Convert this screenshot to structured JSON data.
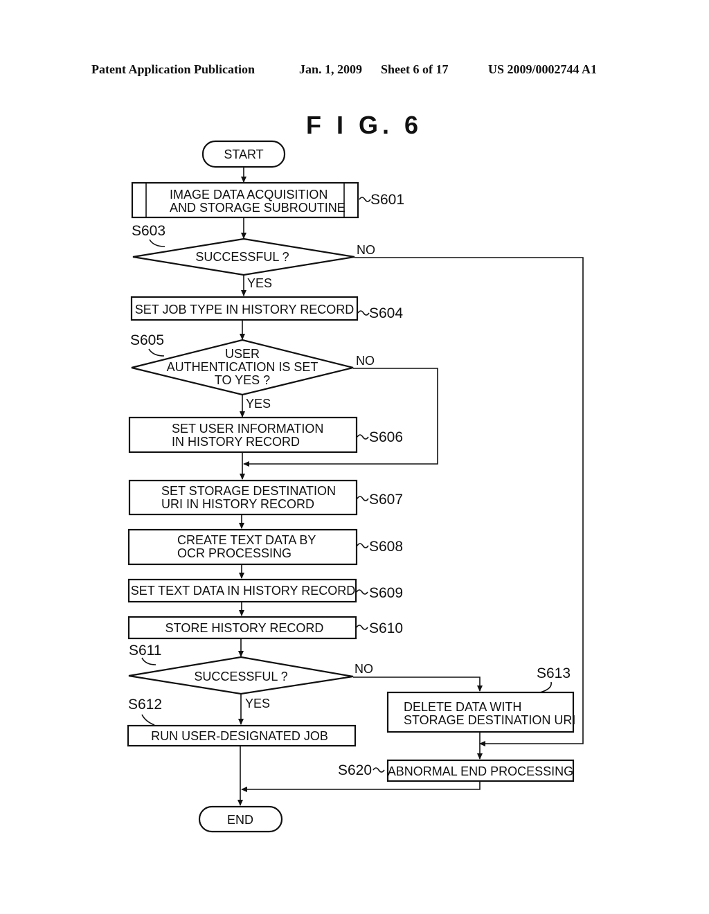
{
  "header": {
    "publication": "Patent Application Publication",
    "date": "Jan. 1, 2009",
    "sheet": "Sheet 6 of 17",
    "number": "US 2009/0002744 A1"
  },
  "figure_title": "F I G. 6",
  "nodes": {
    "start": "START",
    "s601": [
      "IMAGE DATA ACQUISITION",
      "AND STORAGE SUBROUTINE"
    ],
    "s603": [
      "SUCCESSFUL ?"
    ],
    "s604": [
      "SET JOB TYPE IN HISTORY RECORD"
    ],
    "s605": [
      "USER",
      "AUTHENTICATION IS SET",
      "TO YES ?"
    ],
    "s606": [
      "SET USER INFORMATION",
      "IN HISTORY RECORD"
    ],
    "s607": [
      "SET STORAGE DESTINATION",
      "URI IN HISTORY RECORD"
    ],
    "s608": [
      "CREATE TEXT DATA BY",
      "OCR PROCESSING"
    ],
    "s609": [
      "SET TEXT DATA IN HISTORY RECORD"
    ],
    "s610": [
      "STORE HISTORY RECORD"
    ],
    "s611": [
      "SUCCESSFUL ?"
    ],
    "s612": [
      "RUN USER-DESIGNATED JOB"
    ],
    "s613": [
      "DELETE DATA WITH",
      "STORAGE DESTINATION URI"
    ],
    "s620": [
      "ABNORMAL END PROCESSING"
    ],
    "end": "END"
  },
  "step_labels": {
    "s601": "S601",
    "s603": "S603",
    "s604": "S604",
    "s605": "S605",
    "s606": "S606",
    "s607": "S607",
    "s608": "S608",
    "s609": "S609",
    "s610": "S610",
    "s611": "S611",
    "s612": "S612",
    "s613": "S613",
    "s620": "S620"
  },
  "branch_labels": {
    "yes": "YES",
    "no": "NO"
  }
}
